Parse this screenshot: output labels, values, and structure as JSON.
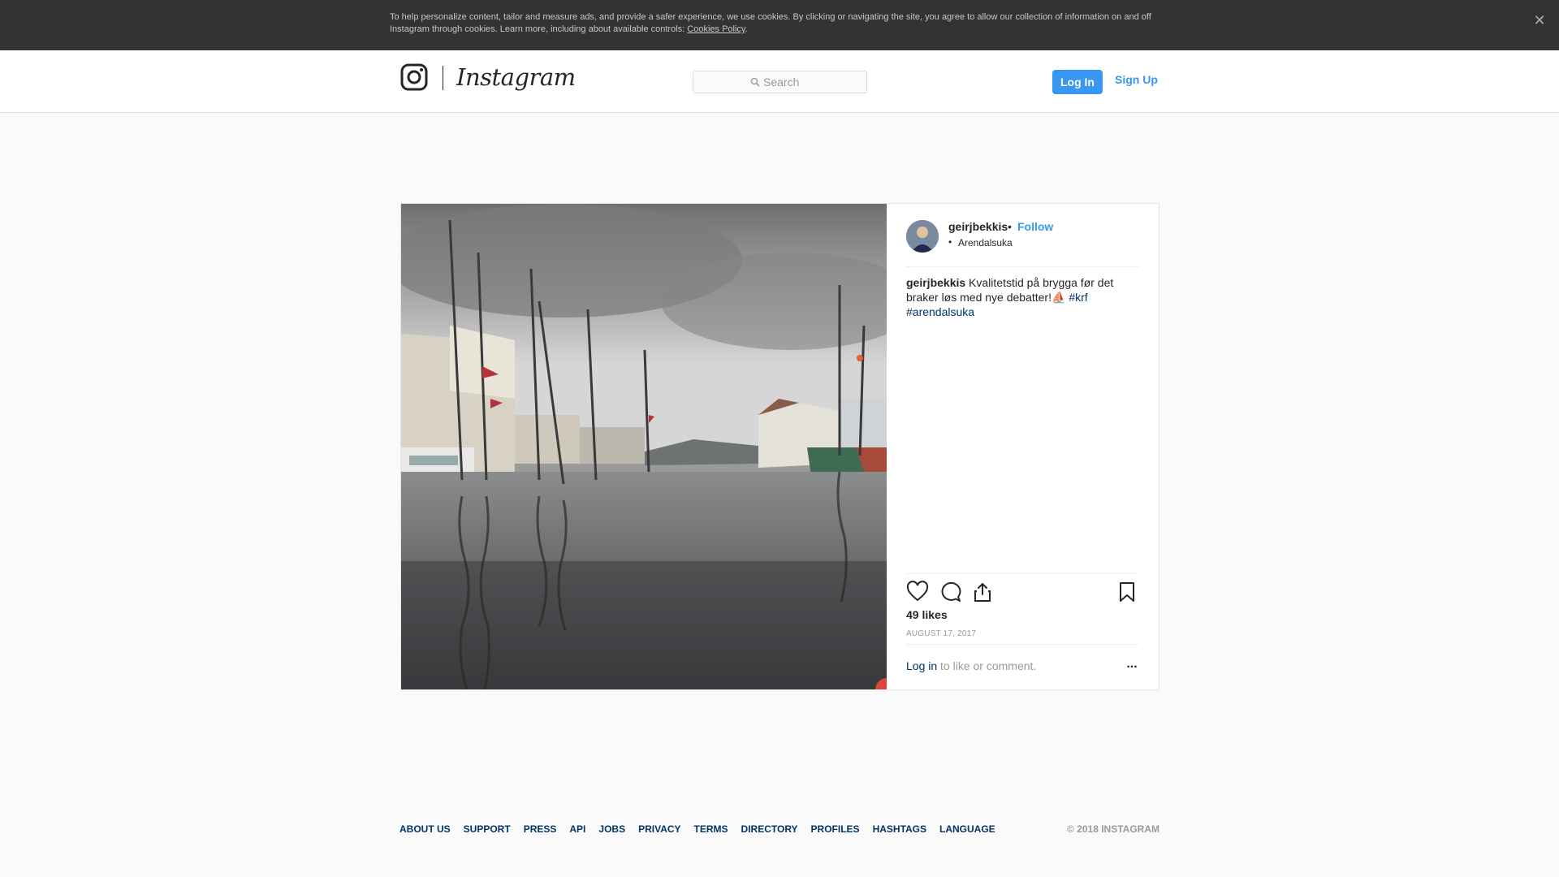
{
  "cookie_banner": {
    "text": "To help personalize content, tailor and measure ads, and provide a safer experience, we use cookies. By clicking or navigating the site, you agree to allow our collection of information on and off Instagram through cookies. Learn more, including about available controls: ",
    "link_label": "Cookies Policy",
    "end": ".",
    "close_icon": "close-icon"
  },
  "header": {
    "logo_text": "Instagram",
    "logo_icon": "camera-glyph-icon",
    "search_placeholder": "Search",
    "login_label": "Log In",
    "signup_label": "Sign Up"
  },
  "post": {
    "username": "geirjbekkis",
    "separator": "•",
    "follow_label": "Follow",
    "location_dot": "•",
    "location": "Arendalsuka",
    "caption_user": "geirjbekkis",
    "caption_text": " Kvalitetstid på brygga før det braker løs med nye debatter!",
    "caption_emoji": "⛵",
    "hashtags": [
      "#krf",
      "#arendalsuka"
    ],
    "likes": "49 likes",
    "date": "AUGUST 17, 2017",
    "login_link": "Log in",
    "comment_prompt": " to like or comment.",
    "more_label": "...",
    "icons": [
      "heart-icon",
      "comment-icon",
      "share-icon",
      "bookmark-icon"
    ]
  },
  "footer": {
    "links": [
      "About us",
      "Support",
      "Press",
      "API",
      "Jobs",
      "Privacy",
      "Terms",
      "Directory",
      "Profiles",
      "Hashtags",
      "Language"
    ],
    "copyright": "© 2018 Instagram"
  },
  "colors": {
    "accent": "#3897f0",
    "link_dark": "#003569",
    "banner": "#333333"
  }
}
